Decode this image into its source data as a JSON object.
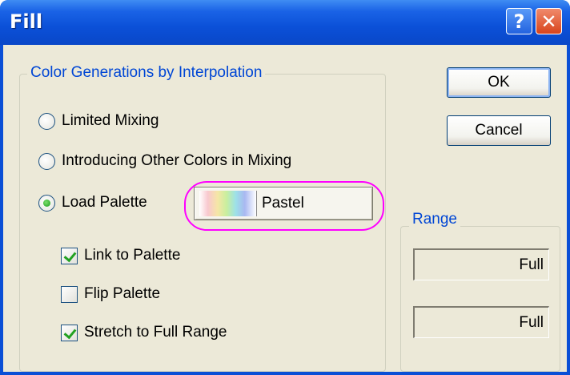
{
  "window": {
    "title": "Fill",
    "help_label": "?",
    "close_label": "✕"
  },
  "buttons": {
    "ok": "OK",
    "cancel": "Cancel"
  },
  "color_group": {
    "title": "Color Generations by Interpolation",
    "options": [
      {
        "label": "Limited Mixing",
        "checked": false
      },
      {
        "label": "Introducing Other Colors in Mixing",
        "checked": false
      },
      {
        "label": "Load Palette",
        "checked": true
      }
    ],
    "palette": {
      "name": "Pastel",
      "swatch_colors": [
        "#ffffff",
        "#f8c8cf",
        "#f6e6a6",
        "#c9ef9e",
        "#9de1e8",
        "#a9b8f1"
      ]
    },
    "checkboxes": [
      {
        "label": "Link to Palette",
        "checked": true
      },
      {
        "label": "Flip Palette",
        "checked": false
      },
      {
        "label": "Stretch to Full Range",
        "checked": true
      }
    ]
  },
  "range_group": {
    "title": "Range",
    "fields": [
      "Full",
      "Full"
    ]
  },
  "colors": {
    "titlebar": "#0a4fd6",
    "group_title": "#0046d5",
    "highlight": "#ff00ff"
  }
}
